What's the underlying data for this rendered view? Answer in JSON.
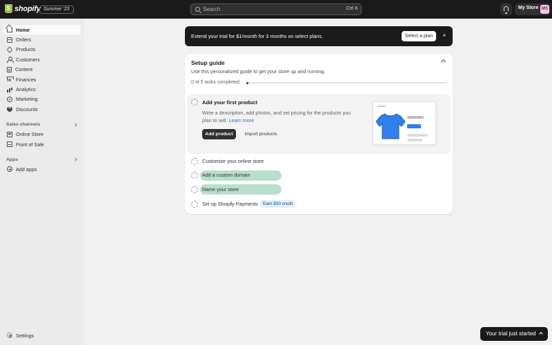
{
  "topbar": {
    "logo_text": "shopify",
    "edition_badge": "Summer '23",
    "search": {
      "placeholder": "Search",
      "shortcut": "Ctrl K"
    },
    "store_name": "My Store",
    "avatar_initials": "MS"
  },
  "sidebar": {
    "main_items": [
      {
        "label": "Home",
        "icon": "home-icon",
        "active": true
      },
      {
        "label": "Orders",
        "icon": "orders-icon"
      },
      {
        "label": "Products",
        "icon": "tag-icon"
      },
      {
        "label": "Customers",
        "icon": "person-icon"
      },
      {
        "label": "Content",
        "icon": "content-icon"
      },
      {
        "label": "Finances",
        "icon": "bank-icon"
      },
      {
        "label": "Analytics",
        "icon": "bar-chart-icon"
      },
      {
        "label": "Marketing",
        "icon": "target-icon"
      },
      {
        "label": "Discounts",
        "icon": "discount-icon"
      }
    ],
    "sales_channels": {
      "heading": "Sales channels",
      "items": [
        {
          "label": "Online Store",
          "icon": "store-icon"
        },
        {
          "label": "Point of Sale",
          "icon": "pos-icon"
        }
      ]
    },
    "apps": {
      "heading": "Apps",
      "items": [
        {
          "label": "Add apps",
          "icon": "plus-circle-icon"
        }
      ]
    },
    "settings_label": "Settings"
  },
  "banner": {
    "text": "Extend your trial for $1/month for 3 months on select plans.",
    "button_label": "Select a plan",
    "close_label": "×"
  },
  "setup_guide": {
    "title": "Setup guide",
    "subtitle": "Use this personalized guide to get your store up and running.",
    "progress_label": "0 of 5 tasks completed",
    "progress_fraction": 0,
    "active_step": {
      "title": "Add your first product",
      "description": "Write a description, add photos, and set pricing for the products you plan to sell.",
      "learn_more": "Learn more",
      "primary_button": "Add product",
      "secondary_button": "Import products"
    },
    "steps": [
      {
        "label": "Customize your online store"
      },
      {
        "label": "Add a custom domain"
      },
      {
        "label": "Name your store"
      },
      {
        "label": "Set up Shopify Payments"
      }
    ],
    "payments_badge": "Earn $50 credit",
    "colors": {
      "highlight_pill": "#b8dfcb",
      "shirt": "#2f80ed"
    }
  },
  "toast": {
    "text": "Your trial just started"
  }
}
